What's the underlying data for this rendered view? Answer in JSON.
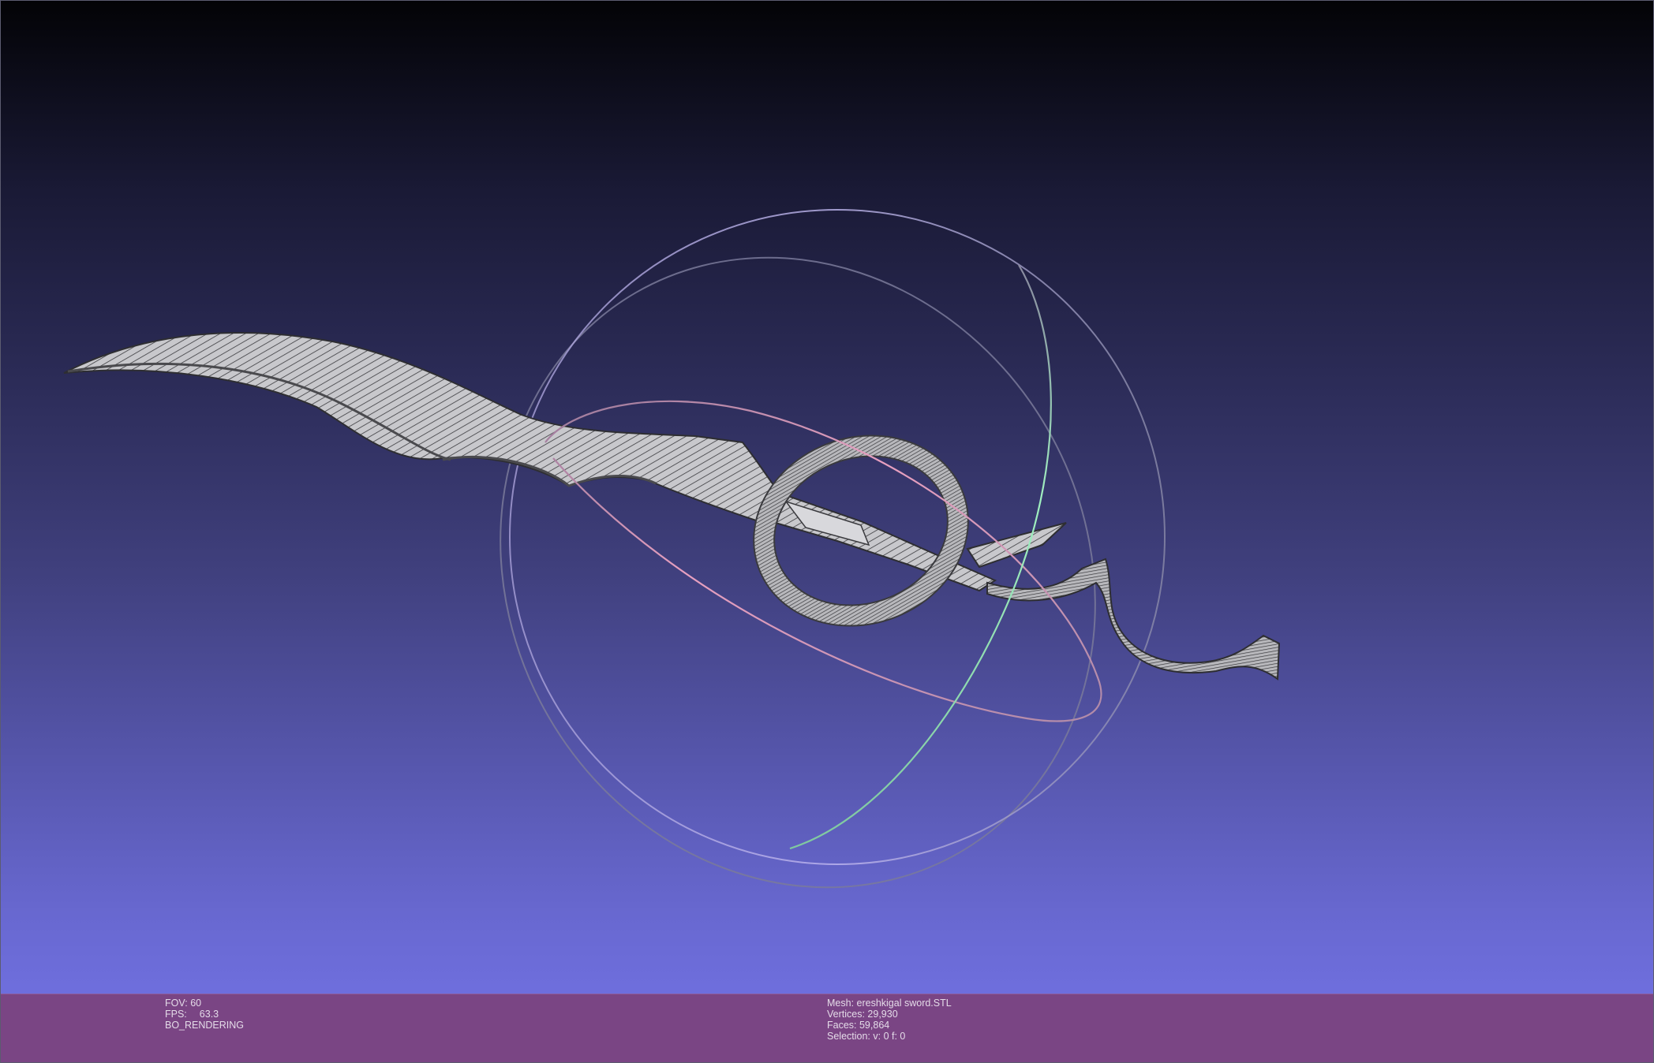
{
  "render_info": {
    "fov_label": "FOV:",
    "fov_value": "60",
    "fps_label": "FPS:",
    "fps_value": "63.3",
    "mode": "BO_RENDERING"
  },
  "mesh_info": {
    "mesh_line": "Mesh: ereshkigal sword.STL",
    "vertices_line": "Vertices: 29,930",
    "faces_line": "Faces: 59,864",
    "selection_line": "Selection: v: 0 f: 0"
  },
  "colors": {
    "info_bar": "#7a4584",
    "gizmo_x": "#e8a0c0",
    "gizmo_y": "#a0f0c0",
    "gizmo_z": "#b0a8f0",
    "mesh_fill": "#cfcfd2",
    "mesh_wire": "#3c3c40"
  }
}
